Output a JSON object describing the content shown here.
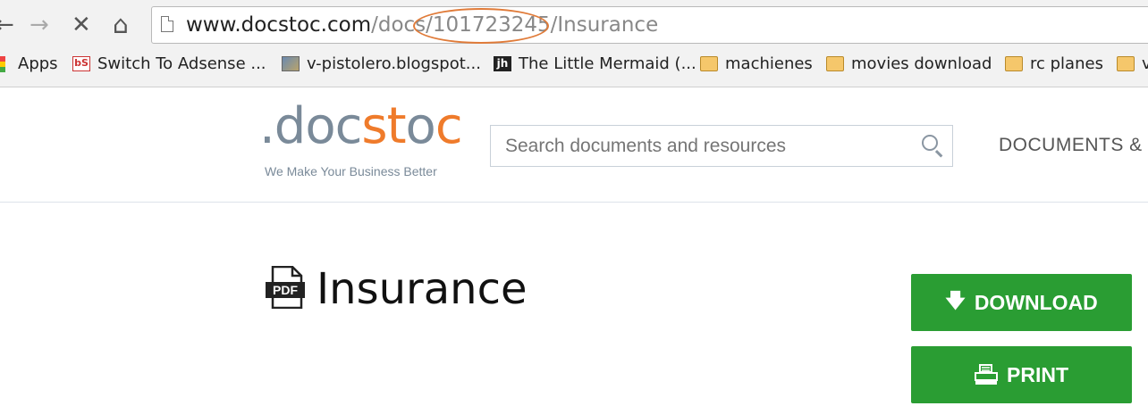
{
  "browser": {
    "nav": {
      "back": "←",
      "forward": "→",
      "stop": "✕",
      "home": "⌂"
    },
    "url": {
      "host": "www.docstoc.com",
      "path_pre": "/docs",
      "highlighted": "/101723245/",
      "path_post": "Insurance"
    },
    "bookmarks": [
      {
        "label": "Apps",
        "icon": "apps-icon"
      },
      {
        "label": "Switch To Adsense ...",
        "icon": "bs-icon"
      },
      {
        "label": "v-pistolero.blogspot...",
        "icon": "image-icon"
      },
      {
        "label": "The Little Mermaid (...",
        "icon": "jh-icon"
      },
      {
        "label": "machienes",
        "icon": "folder-icon"
      },
      {
        "label": "movies download",
        "icon": "folder-icon"
      },
      {
        "label": "rc planes",
        "icon": "folder-icon"
      },
      {
        "label": "v",
        "icon": "folder-icon"
      }
    ]
  },
  "site": {
    "logo": {
      "part1": ".doc",
      "part2": "st",
      "part3": "o",
      "part4": "c"
    },
    "tagline": "We Make Your Business Better",
    "search_placeholder": "Search documents and resources",
    "nav_text": "DOCUMENTS & V"
  },
  "document": {
    "title": "Insurance",
    "type_badge": "PDF",
    "download_label": "DOWNLOAD",
    "print_label": "PRINT"
  },
  "colors": {
    "brand_orange": "#ef7b2b",
    "brand_gray": "#7a8a99",
    "button_green": "#2a9d33",
    "annotation_circle": "#e07b39"
  }
}
